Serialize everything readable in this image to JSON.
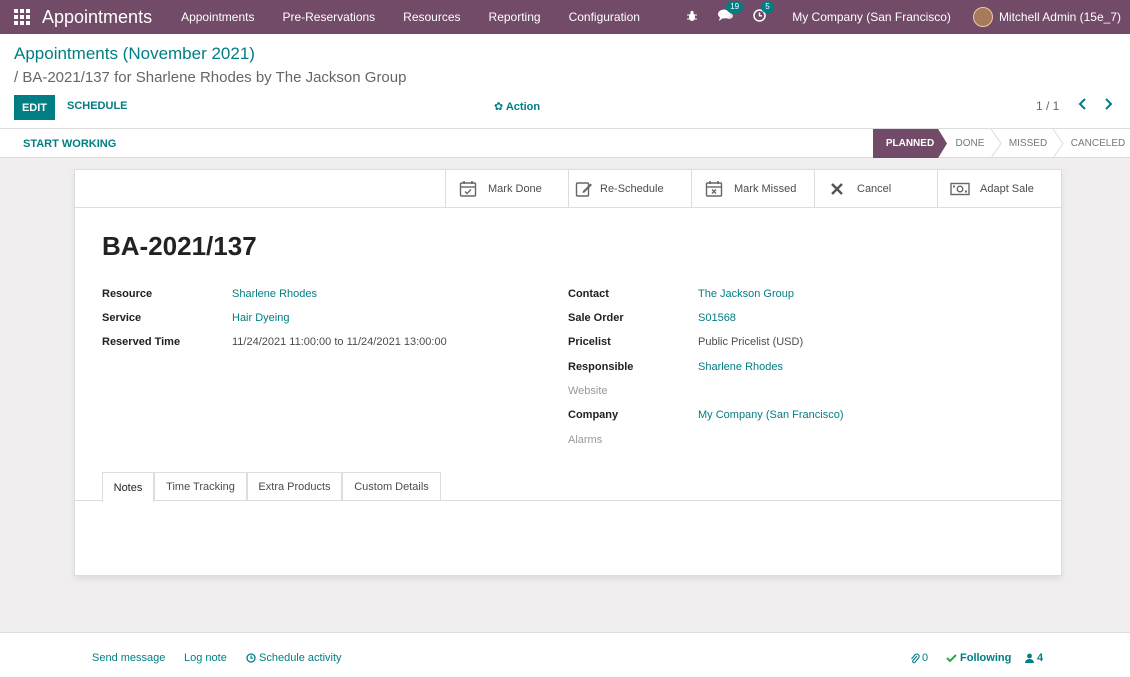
{
  "navbar": {
    "brand": "Appointments",
    "menu": [
      "Appointments",
      "Pre-Reservations",
      "Resources",
      "Reporting",
      "Configuration"
    ],
    "messages_count": "19",
    "activities_count": "5",
    "company": "My Company (San Francisco)",
    "user": "Mitchell Admin (15e_7)"
  },
  "control": {
    "breadcrumb_root": "Appointments (November 2021)",
    "breadcrumb_active": "/ BA-2021/137 for Sharlene Rhodes by The Jackson Group",
    "edit_label": "EDIT",
    "schedule_label": "SCHEDULE",
    "action_label": "✿ Action",
    "pager": "1 / 1"
  },
  "statusbar": {
    "start_working": "START WORKING",
    "stages": [
      "PLANNED",
      "DONE",
      "MISSED",
      "CANCELED"
    ],
    "active_stage": "PLANNED"
  },
  "buttons": [
    "Mark Done",
    "Re-Schedule",
    "Mark Missed",
    "Cancel",
    "Adapt Sale"
  ],
  "record": {
    "name": "BA-2021/137",
    "left_fields": [
      {
        "label": "Resource",
        "value": "Sharlene Rhodes"
      },
      {
        "label": "Service",
        "value": "Hair Dyeing"
      },
      {
        "label": "Reserved Time",
        "value": "11/24/2021 11:00:00 to 11/24/2021 13:00:00"
      }
    ],
    "right_fields": [
      {
        "label": "Contact",
        "value": "The Jackson Group"
      },
      {
        "label": "Sale Order",
        "value": "S01568"
      },
      {
        "label": "Pricelist",
        "value": "Public Pricelist (USD)"
      },
      {
        "label": "Responsible",
        "value": "Sharlene Rhodes"
      },
      {
        "label": "Website",
        "value": ""
      },
      {
        "label": "Company",
        "value": "My Company (San Francisco)"
      },
      {
        "label": "Alarms",
        "value": ""
      }
    ]
  },
  "tabs": [
    "Notes",
    "Time Tracking",
    "Extra Products",
    "Custom Details"
  ],
  "chatter": {
    "send_message": "Send message",
    "log_note": "Log note",
    "schedule_activity": "Schedule activity",
    "attachments": "0",
    "following": "Following",
    "followers": "4"
  }
}
